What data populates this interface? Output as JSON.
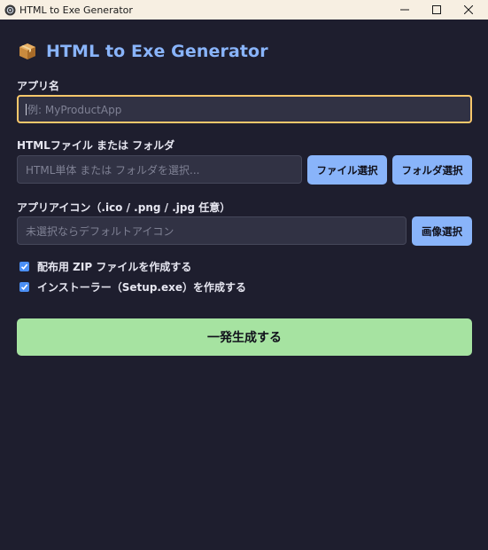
{
  "window": {
    "title": "HTML to Exe Generator",
    "controls": [
      "minimize-icon",
      "maximize-icon",
      "close-icon"
    ]
  },
  "header": {
    "icon": "package-icon",
    "title": "HTML to Exe Generator"
  },
  "form": {
    "app_name": {
      "label": "アプリ名",
      "placeholder": "例: MyProductApp",
      "value": ""
    },
    "html_source": {
      "label": "HTMLファイル または フォルダ",
      "placeholder": "HTML単体 または フォルダを選択...",
      "file_button": "ファイル選択",
      "folder_button": "フォルダ選択"
    },
    "app_icon": {
      "label": "アプリアイコン（.ico / .png / .jpg 任意）",
      "placeholder": "未選択ならデフォルトアイコン",
      "image_button": "画像選択"
    },
    "options": [
      {
        "label": "配布用 ZIP ファイルを作成する",
        "checked": true
      },
      {
        "label": "インストーラー（Setup.exe）を作成する",
        "checked": true
      }
    ],
    "generate_button": "一発生成する"
  },
  "colors": {
    "background": "#1e1e2e",
    "accent": "#89b4fa",
    "generate": "#a6e3a1",
    "focus_border": "#f9c86b"
  }
}
